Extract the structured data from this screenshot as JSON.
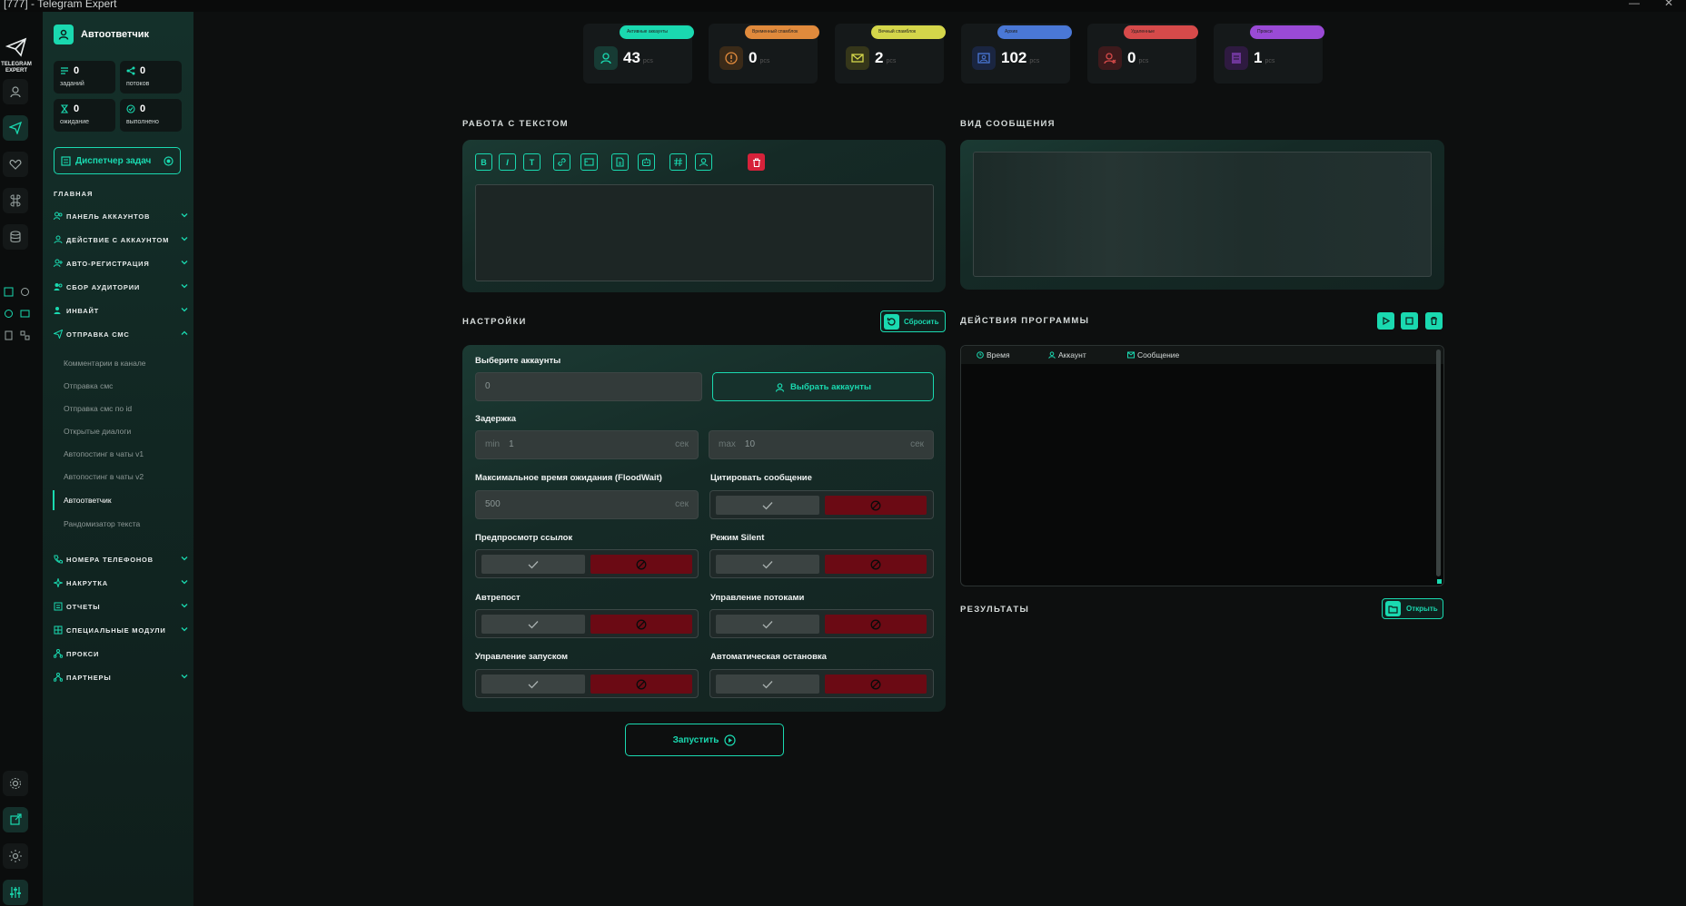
{
  "window": {
    "title": "[777] - Telegram Expert",
    "min": "—",
    "close": "✕"
  },
  "logo": {
    "line1": "TELEGRAM",
    "line2": "EXPERT"
  },
  "sidebar": {
    "app_name": "Автоответчик",
    "stats": [
      {
        "value": "0",
        "label": "заданий"
      },
      {
        "value": "0",
        "label": "потоков"
      },
      {
        "value": "0",
        "label": "ожидание"
      },
      {
        "value": "0",
        "label": "выполнено"
      }
    ],
    "dispatcher_label": "Диспетчер задач",
    "section_main": "ГЛАВНАЯ",
    "nav": [
      {
        "label": "ПАНЕЛЬ АККАУНТОВ"
      },
      {
        "label": "ДЕЙСТВИЕ С АККАУНТОМ"
      },
      {
        "label": "АВТО-РЕГИСТРАЦИЯ"
      },
      {
        "label": "СБОР АУДИТОРИИ"
      },
      {
        "label": "ИНВАЙТ"
      },
      {
        "label": "ОТПРАВКА СМС"
      }
    ],
    "sub": [
      "Комментарии в канале",
      "Отправка смс",
      "Отправка смс по id",
      "Открытые диалоги",
      "Автопостинг в чаты v1",
      "Автопостинг в чаты v2",
      "Автоответчик",
      "Рандомизатор текста"
    ],
    "nav2": [
      {
        "label": "НОМЕРА ТЕЛЕФОНОВ"
      },
      {
        "label": "НАКРУТКА"
      },
      {
        "label": "ОТЧЕТЫ"
      },
      {
        "label": "СПЕЦИАЛЬНЫЕ МОДУЛИ"
      },
      {
        "label": "ПРОКСИ"
      },
      {
        "label": "ПАРТНЕРЫ"
      }
    ]
  },
  "cards": [
    {
      "tag": "Активные аккаунты",
      "value": "43",
      "unit": "pcs",
      "color": "#1ad9b0"
    },
    {
      "tag": "Временный спамблок",
      "value": "0",
      "unit": "pcs",
      "color": "#e08a3c"
    },
    {
      "tag": "Вечный спамблок",
      "value": "2",
      "unit": "pcs",
      "color": "#d4d64a"
    },
    {
      "tag": "Архив",
      "value": "102",
      "unit": "pcs",
      "color": "#4a78d6"
    },
    {
      "tag": "Удаленные",
      "value": "0",
      "unit": "pcs",
      "color": "#d64a4a"
    },
    {
      "tag": "Прокси",
      "value": "1",
      "unit": "pcs",
      "color": "#9a4ad6"
    }
  ],
  "text_work": {
    "title": "РАБОТА С ТЕКСТОМ",
    "format_buttons": [
      "B",
      "I",
      "T"
    ]
  },
  "message_view": {
    "title": "ВИД СООБЩЕНИЯ"
  },
  "settings": {
    "title": "НАСТРОЙКИ",
    "reset_label": "Сбросить",
    "select_accounts_label": "Выберите аккаунты",
    "accounts_value": "0",
    "select_accounts_button": "Выбрать аккаунты",
    "delay_label": "Задержка",
    "delay_min_prefix": "min",
    "delay_min_value": "1",
    "delay_max_prefix": "max",
    "delay_max_value": "10",
    "unit": "сек",
    "floodwait_label": "Максимальное время ожидания (FloodWait)",
    "floodwait_value": "500",
    "quote_label": "Цитировать сообщение",
    "link_preview_label": "Предпросмотр ссылок",
    "silent_label": "Режим Silent",
    "repost_label": "Автрепост",
    "threads_label": "Управление потоками",
    "launch_control_label": "Управление запуском",
    "auto_stop_label": "Автоматическая остановка",
    "run_label": "Запустить"
  },
  "program_actions": {
    "title": "ДЕЙСТВИЯ ПРОГРАММЫ",
    "col_time": "Время",
    "col_account": "Аккаунт",
    "col_message": "Сообщение"
  },
  "results": {
    "title": "РЕЗУЛЬТАТЫ",
    "open_label": "Открыть"
  },
  "colors": {
    "accent": "#1ad9b0",
    "danger": "#6b0a14",
    "bg": "#0d0f0f"
  }
}
